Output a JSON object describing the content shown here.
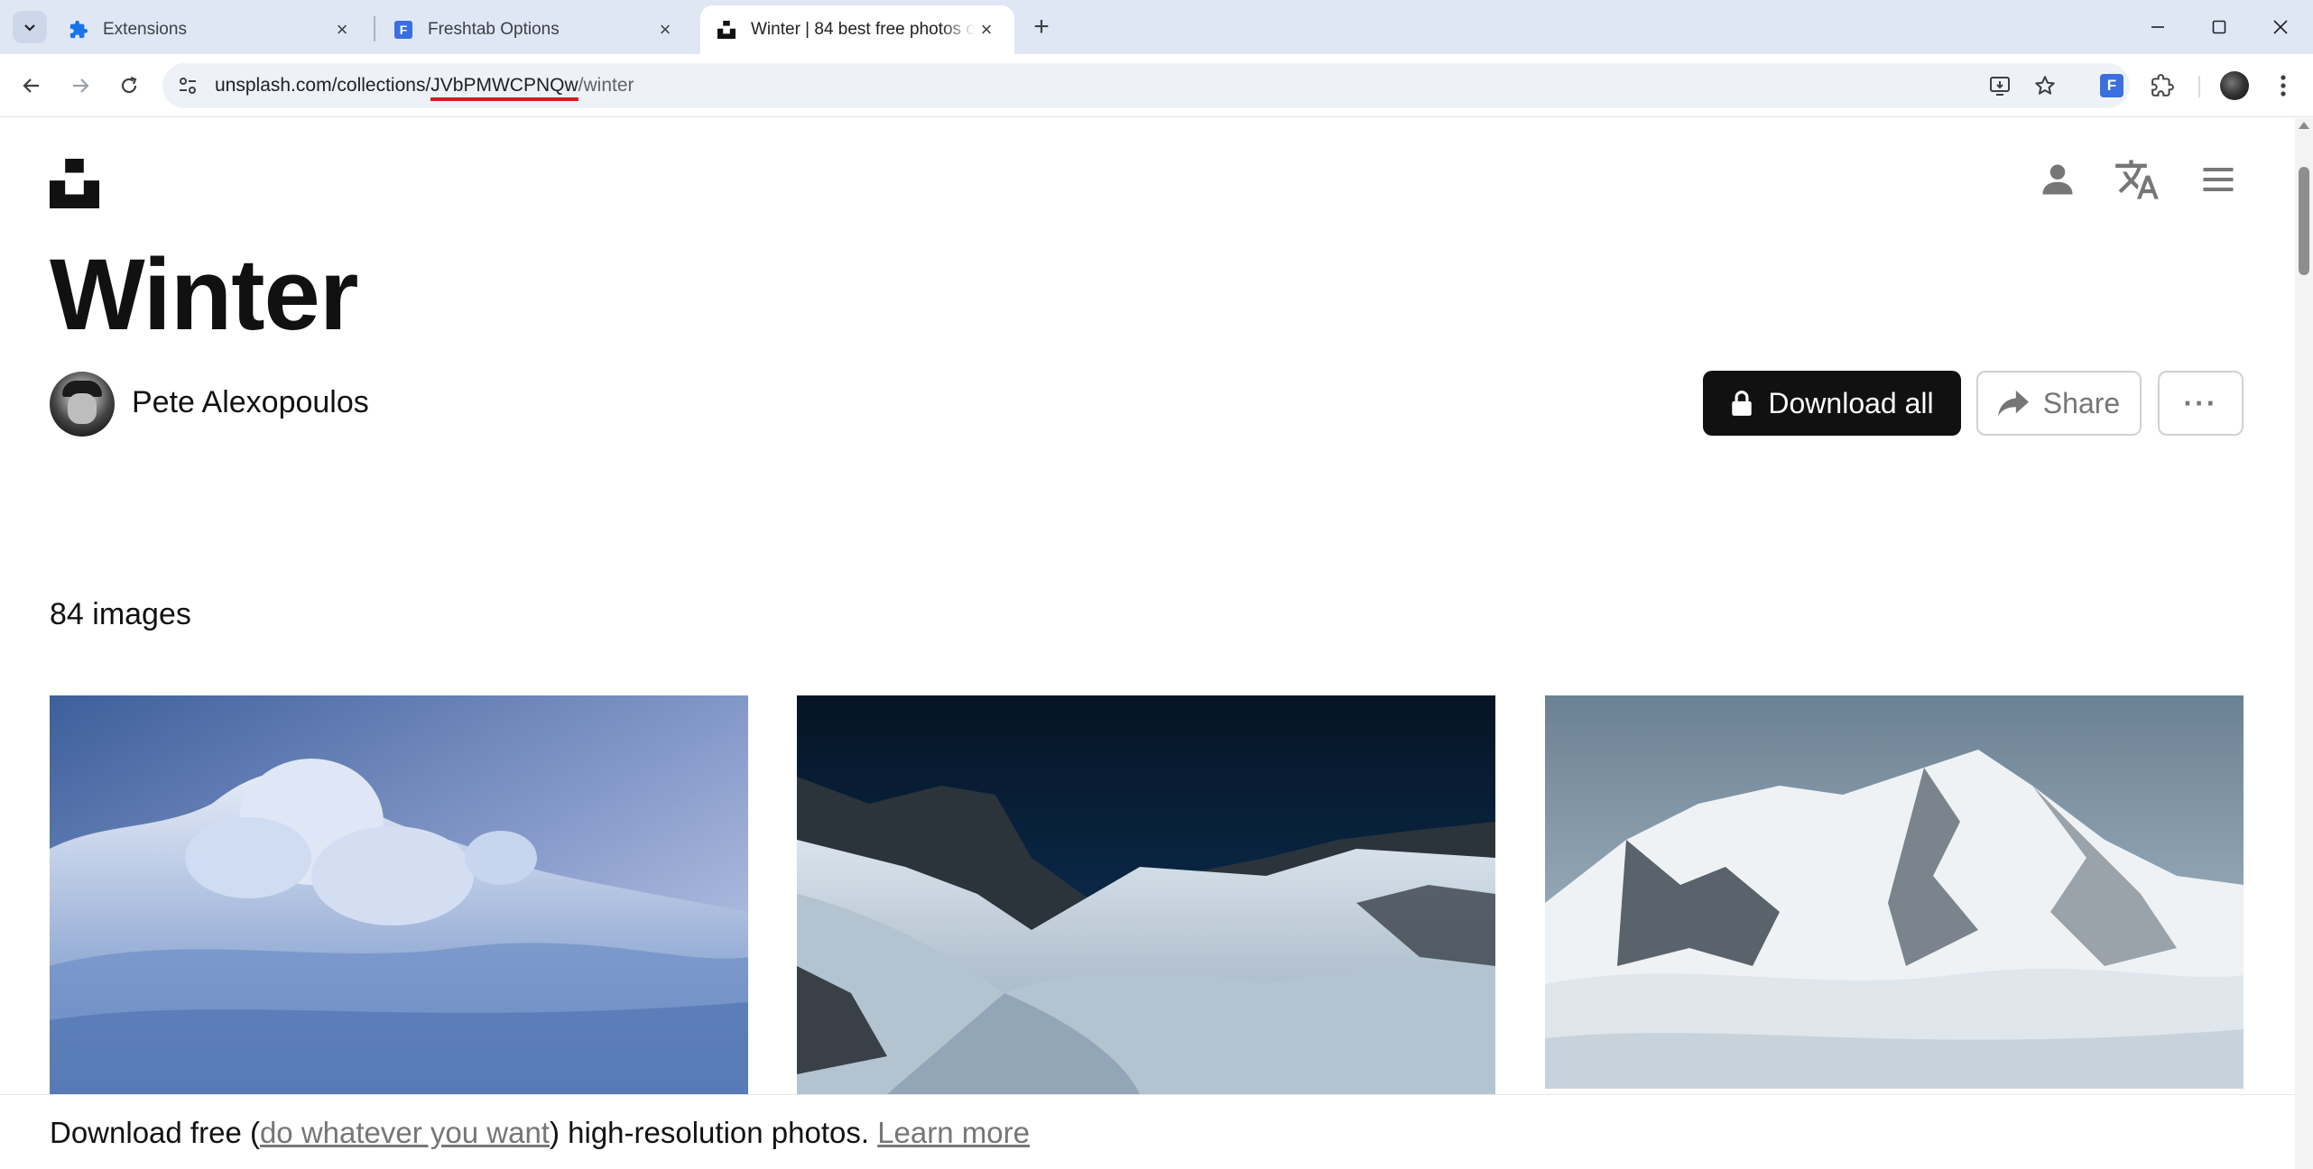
{
  "browser": {
    "tabs": [
      {
        "title": "Extensions",
        "icon": "puzzle-icon",
        "active": false
      },
      {
        "title": "Freshtab Options",
        "icon": "freshtab-icon",
        "active": false
      },
      {
        "title": "Winter | 84 best free photos on",
        "icon": "unsplash-icon",
        "active": true
      }
    ],
    "url": {
      "prefix": "unsplash.com/collections/",
      "highlighted": "JVbPMWCPNQw",
      "suffix": "/winter"
    },
    "ext_letter": "F",
    "colors": {
      "tabbar": "#dfe7f5",
      "url_highlight": "#d41f1f",
      "ext": "#3a6fe0"
    }
  },
  "page": {
    "title": "Winter",
    "author": "Pete Alexopoulos",
    "buttons": {
      "download_all": "Download all",
      "share": "Share",
      "more": "···"
    },
    "count": "84 images",
    "banner": {
      "prefix": "Download free (",
      "link1": "do whatever you want",
      "middle": ") high-resolution photos. ",
      "link2": "Learn more"
    }
  }
}
